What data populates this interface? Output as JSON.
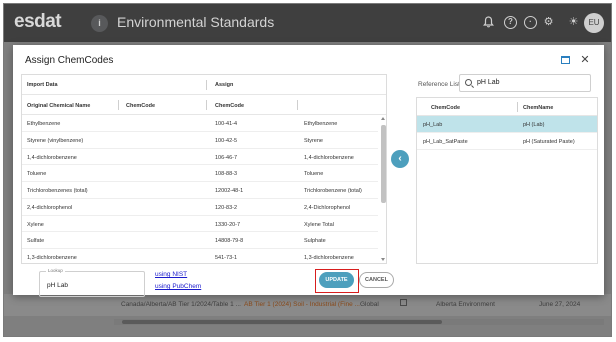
{
  "app": {
    "logo": "esdat",
    "logo_badge": "i",
    "title": "Environmental Standards",
    "avatar": "EU"
  },
  "background_row": {
    "cells": [
      "Canada/Alberta/AB Tier 1/2024/Table 1 ...",
      "AB Tier 1 (2024) Soil - Industrial (Fine ...",
      "Global",
      "Alberta Environment",
      "June 27, 2024"
    ]
  },
  "modal": {
    "title": "Assign ChemCodes",
    "left_table": {
      "group_headers": [
        "Import Data",
        "Assign"
      ],
      "columns": [
        "Original Chemical Name",
        "ChemCode",
        "ChemCode",
        ""
      ],
      "rows": [
        [
          "Ethylbenzene",
          "",
          "100-41-4",
          "Ethylbenzene"
        ],
        [
          "Styrene (vinylbenzene)",
          "",
          "100-42-5",
          "Styrene"
        ],
        [
          "1,4-dichlorobenzene",
          "",
          "106-46-7",
          "1,4-dichlorobenzene"
        ],
        [
          "Toluene",
          "",
          "108-88-3",
          "Toluene"
        ],
        [
          "Trichlorobenzenes (total)",
          "",
          "12002-48-1",
          "Trichlorobenzene (total)"
        ],
        [
          "2,4-dichlorophenol",
          "",
          "120-83-2",
          "2,4-Dichlorophenol"
        ],
        [
          "Xylene",
          "",
          "1330-20-7",
          "Xylene Total"
        ],
        [
          "Sulfate",
          "",
          "14808-79-8",
          "Sulphate"
        ],
        [
          "1,3-dichlorobenzene",
          "",
          "541-73-1",
          "1,3-dichlorobenzene"
        ]
      ]
    },
    "transfer_glyph": "‹",
    "reference": {
      "label": "Reference List",
      "search_value": "pH Lab",
      "columns": [
        "ChemCode",
        "ChemName"
      ],
      "rows": [
        [
          "pH_Lab",
          "pH (Lab)"
        ],
        [
          "pH_Lab_SatPaste",
          "pH (Saturated Paste)"
        ]
      ],
      "selected_row": 0
    },
    "footer": {
      "lookup_label": "Lookup",
      "lookup_value": "pH Lab",
      "link_nist": "using NIST",
      "link_pubchem": "using PubChem",
      "update_label": "UPDATE",
      "cancel_label": "CANCEL"
    }
  },
  "colors": {
    "accent": "#4d9fbd",
    "selected_row": "#bfe3ea",
    "highlight_outline": "#d81e1e"
  }
}
